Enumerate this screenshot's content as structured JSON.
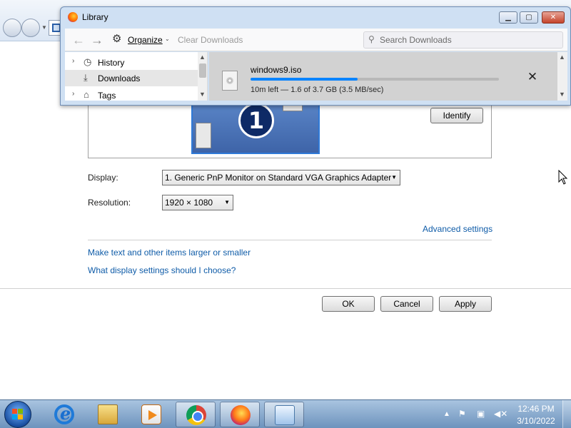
{
  "library": {
    "title": "Library",
    "toolbar": {
      "organize_label": "Organize",
      "clear_downloads_label": "Clear Downloads",
      "search_placeholder": "Search Downloads"
    },
    "sidebar": {
      "items": [
        {
          "label": "History",
          "icon": "clock-icon",
          "selected": false
        },
        {
          "label": "Downloads",
          "icon": "download-icon",
          "selected": true
        },
        {
          "label": "Tags",
          "icon": "tag-icon",
          "selected": false
        }
      ]
    },
    "download": {
      "filename": "windows9.iso",
      "status": "10m left — 1.6 of 3.7 GB (3.5 MB/sec)",
      "progress_fraction": 0.43
    }
  },
  "display_settings": {
    "identify_label": "Identify",
    "display_label": "Display:",
    "display_value": "1. Generic PnP Monitor on Standard VGA Graphics Adapter",
    "resolution_label": "Resolution:",
    "resolution_value": "1920 × 1080",
    "monitor_number": "1",
    "advanced_link": "Advanced settings",
    "text_size_link": "Make text and other items larger or smaller",
    "which_settings_link": "What display settings should I choose?",
    "ok_label": "OK",
    "cancel_label": "Cancel",
    "apply_label": "Apply"
  },
  "taskbar": {
    "time": "12:46 PM",
    "date": "3/10/2022",
    "apps": [
      "Internet Explorer",
      "Windows Explorer",
      "Windows Media Player",
      "Google Chrome",
      "Firefox",
      "Control Panel"
    ]
  },
  "colors": {
    "progress": "#0a84ff",
    "link": "#0f5ca8"
  }
}
